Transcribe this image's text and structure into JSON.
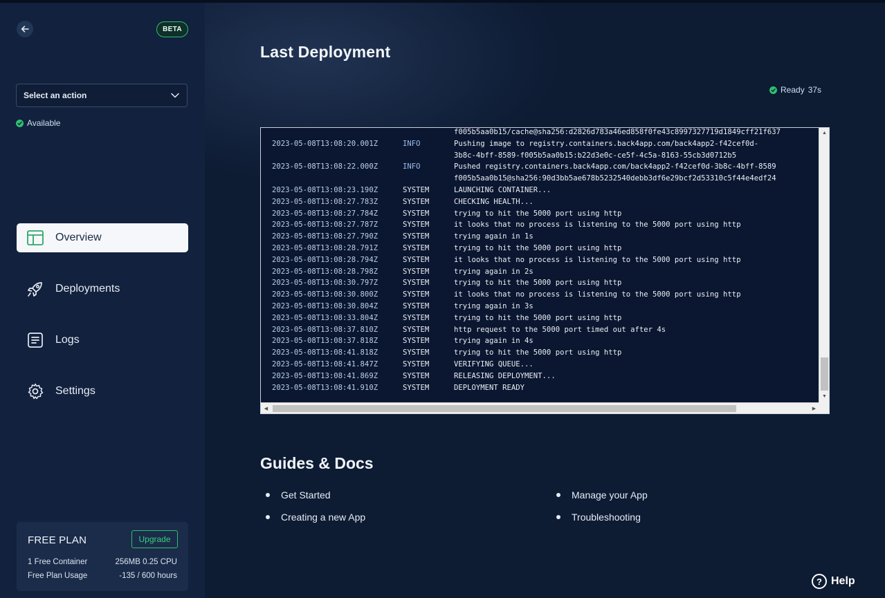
{
  "sidebar": {
    "beta_label": "BETA",
    "action_select": {
      "value": "Select an action"
    },
    "status": "Available",
    "nav": [
      {
        "label": "Overview",
        "icon": "layout-icon",
        "active": true
      },
      {
        "label": "Deployments",
        "icon": "rocket-icon",
        "active": false
      },
      {
        "label": "Logs",
        "icon": "document-lines-icon",
        "active": false
      },
      {
        "label": "Settings",
        "icon": "gear-icon",
        "active": false
      }
    ],
    "plan": {
      "title": "FREE PLAN",
      "upgrade_label": "Upgrade",
      "rows": [
        {
          "label": "1 Free Container",
          "value": "256MB 0.25 CPU"
        },
        {
          "label": "Free Plan Usage",
          "value": "-135 / 600 hours"
        }
      ]
    }
  },
  "main": {
    "title": "Last Deployment",
    "status_label": "Ready",
    "status_time": "37s",
    "logs": [
      {
        "ts": "",
        "level": "",
        "msg": "f005b5aa0b15/cache@sha256:d2826d783a46ed858f0fe43c8997327719d1849cff21f637"
      },
      {
        "ts": "2023-05-08T13:08:20.001Z",
        "level": "INFO",
        "msg": "Pushing image to registry.containers.back4app.com/back4app2-f42cef0d-"
      },
      {
        "ts": "",
        "level": "",
        "msg": "3b8c-4bff-8589-f005b5aa0b15:b22d3e0c-ce5f-4c5a-8163-55cb3d0712b5"
      },
      {
        "ts": "2023-05-08T13:08:22.000Z",
        "level": "INFO",
        "msg": "Pushed registry.containers.back4app.com/back4app2-f42cef0d-3b8c-4bff-8589"
      },
      {
        "ts": "",
        "level": "",
        "msg": "f005b5aa0b15@sha256:90d3bb5ae678b5232540debb3df6e29bcf2d53310c5f44e4edf24"
      },
      {
        "ts": "2023-05-08T13:08:23.190Z",
        "level": "SYSTEM",
        "msg": "LAUNCHING CONTAINER..."
      },
      {
        "ts": "2023-05-08T13:08:27.783Z",
        "level": "SYSTEM",
        "msg": "CHECKING HEALTH..."
      },
      {
        "ts": "2023-05-08T13:08:27.784Z",
        "level": "SYSTEM",
        "msg": "trying to hit the 5000 port using http"
      },
      {
        "ts": "2023-05-08T13:08:27.787Z",
        "level": "SYSTEM",
        "msg": "it looks that no process is listening to the 5000 port using http"
      },
      {
        "ts": "2023-05-08T13:08:27.790Z",
        "level": "SYSTEM",
        "msg": "trying again in 1s"
      },
      {
        "ts": "2023-05-08T13:08:28.791Z",
        "level": "SYSTEM",
        "msg": "trying to hit the 5000 port using http"
      },
      {
        "ts": "2023-05-08T13:08:28.794Z",
        "level": "SYSTEM",
        "msg": "it looks that no process is listening to the 5000 port using http"
      },
      {
        "ts": "2023-05-08T13:08:28.798Z",
        "level": "SYSTEM",
        "msg": "trying again in 2s"
      },
      {
        "ts": "2023-05-08T13:08:30.797Z",
        "level": "SYSTEM",
        "msg": "trying to hit the 5000 port using http"
      },
      {
        "ts": "2023-05-08T13:08:30.800Z",
        "level": "SYSTEM",
        "msg": "it looks that no process is listening to the 5000 port using http"
      },
      {
        "ts": "2023-05-08T13:08:30.804Z",
        "level": "SYSTEM",
        "msg": "trying again in 3s"
      },
      {
        "ts": "2023-05-08T13:08:33.804Z",
        "level": "SYSTEM",
        "msg": "trying to hit the 5000 port using http"
      },
      {
        "ts": "2023-05-08T13:08:37.810Z",
        "level": "SYSTEM",
        "msg": "http request to the 5000 port timed out after 4s"
      },
      {
        "ts": "2023-05-08T13:08:37.818Z",
        "level": "SYSTEM",
        "msg": "trying again in 4s"
      },
      {
        "ts": "2023-05-08T13:08:41.818Z",
        "level": "SYSTEM",
        "msg": "trying to hit the 5000 port using http"
      },
      {
        "ts": "2023-05-08T13:08:41.847Z",
        "level": "SYSTEM",
        "msg": "VERIFYING QUEUE..."
      },
      {
        "ts": "2023-05-08T13:08:41.869Z",
        "level": "SYSTEM",
        "msg": "RELEASING DEPLOYMENT..."
      },
      {
        "ts": "2023-05-08T13:08:41.910Z",
        "level": "SYSTEM",
        "msg": "DEPLOYMENT READY"
      }
    ],
    "guides": {
      "title": "Guides & Docs",
      "links": [
        "Get Started",
        "Creating a new App",
        "Manage your App",
        "Troubleshooting"
      ]
    },
    "help_label": "Help"
  },
  "colors": {
    "background": "#0d1b33",
    "sidebar": "#12213d",
    "accent_green": "#2fbf71",
    "active_nav": "#f5f7fa"
  }
}
